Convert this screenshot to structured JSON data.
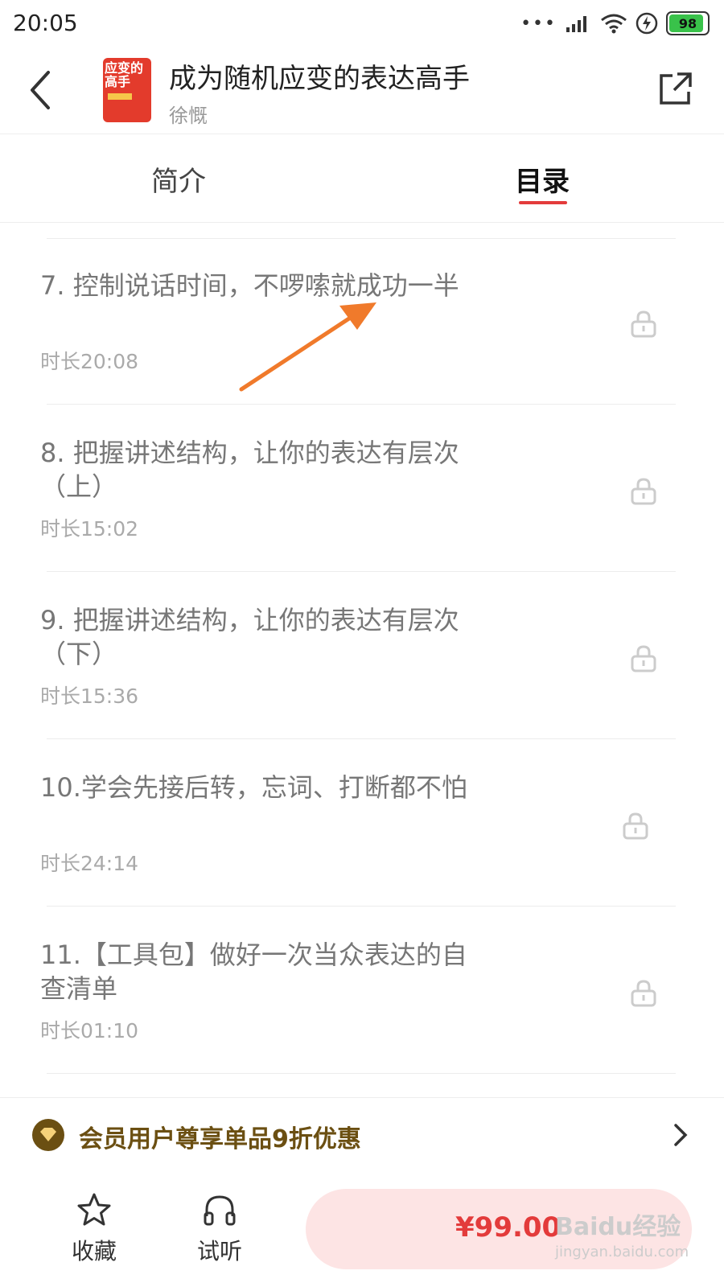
{
  "status_bar": {
    "time": "20:05",
    "battery": "98"
  },
  "header": {
    "cover_text": "应变的高手",
    "title": "成为随机应变的表达高手",
    "author": "徐慨"
  },
  "tabs": [
    {
      "label": "简介",
      "active": false
    },
    {
      "label": "目录",
      "active": true
    }
  ],
  "episodes": [
    {
      "title": "7. 控制说话时间，不啰嗦就成功一半",
      "duration": "时长20:08",
      "locked": true
    },
    {
      "title": "8. 把握讲述结构，让你的表达有层次（上）",
      "duration": "时长15:02",
      "locked": true
    },
    {
      "title": "9. 把握讲述结构，让你的表达有层次（下）",
      "duration": "时长15:36",
      "locked": true
    },
    {
      "title": "10.学会先接后转，忘词、打断都不怕",
      "duration": "时长24:14",
      "locked": true
    },
    {
      "title": "11.【工具包】做好一次当众表达的自查清单",
      "duration": "时长01:10",
      "locked": true
    }
  ],
  "promo": {
    "text": "会员用户尊享单品9折优惠"
  },
  "bottom_bar": {
    "favorite_label": "收藏",
    "listen_label": "试听",
    "price": "¥99.00"
  },
  "watermark": {
    "brand": "Baidu经验",
    "url": "jingyan.baidu.com"
  },
  "colors": {
    "accent": "#e33b3b",
    "promo": "#6b4f12",
    "arrow": "#f07a2b"
  }
}
